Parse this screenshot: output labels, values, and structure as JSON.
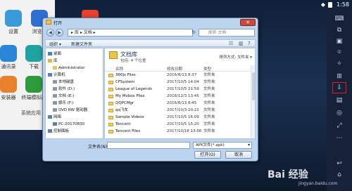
{
  "status_bar": {
    "time": "1:58"
  },
  "desktop": {
    "apps": [
      {
        "label": "设置",
        "color": "#3a9ad9"
      },
      {
        "label": "浏览器",
        "color": "#2f6fd0"
      },
      {
        "label": "通讯录",
        "color": "#2a86d6"
      },
      {
        "label": "下载",
        "color": "#1fa3a0"
      },
      {
        "label": "安装器",
        "color": "#e8812b"
      },
      {
        "label": "终端模拟器",
        "color": "#2d9b3c"
      }
    ],
    "folder_label": "系统应用",
    "brand_red": "#e8402a"
  },
  "dialog": {
    "title": "打开",
    "close": "✕",
    "address": "▸ 库 ▸ 文档 ▸",
    "search_placeholder": "搜索 文档",
    "toolbar": {
      "organize": "组织 ▾",
      "new_folder": "新建文件夹"
    },
    "nav_tree": [
      {
        "label": "桌面",
        "icon_color": "#4a7ec4",
        "indent": 0
      },
      {
        "label": "库",
        "icon_color": "#e0b84a",
        "indent": 0
      },
      {
        "label": "Administrator",
        "icon_color": "#e8c35a",
        "indent": 1
      },
      {
        "label": "计算机",
        "icon_color": "#5b7fa8",
        "indent": 0
      },
      {
        "label": "本地磁盘",
        "icon_color": "#8a97a8",
        "indent": 1
      },
      {
        "label": "软件 (D:)",
        "icon_color": "#8a97a8",
        "indent": 1
      },
      {
        "label": "文档 (E:)",
        "icon_color": "#8a97a8",
        "indent": 1
      },
      {
        "label": "娱乐 (F:)",
        "icon_color": "#8a97a8",
        "indent": 1
      },
      {
        "label": "DVD RW 驱动器",
        "icon_color": "#8a97a8",
        "indent": 1
      },
      {
        "label": "网络",
        "icon_color": "#5b7fa8",
        "indent": 0
      },
      {
        "label": "PC-20170830",
        "icon_color": "#5b7fa8",
        "indent": 1
      },
      {
        "label": "控制面板",
        "icon_color": "#5b7fa8",
        "indent": 0
      }
    ],
    "library": {
      "title": "文档库",
      "subtitle": "包括: 4 个位置",
      "arrange": "排列方式: 文件夹 ▾"
    },
    "columns": {
      "name": "名称",
      "date": "修改日期",
      "type": "类型"
    },
    "files": [
      {
        "name": "360js Files",
        "date": "2016/8/13 8:37",
        "type": "文件夹"
      },
      {
        "name": "CFSystem",
        "date": "2017/10/5 14:04",
        "type": "文件夹"
      },
      {
        "name": "League of Legends",
        "date": "2017/10/5 21:59",
        "type": "文件夹"
      },
      {
        "name": "My Mvbox Files",
        "date": "2016/12/3 13:45",
        "type": "文件夹"
      },
      {
        "name": "QQPCMgr",
        "date": "2016/8/13 8:45",
        "type": "文件夹"
      },
      {
        "name": "qq飞车",
        "date": "2017/10/3 20:21",
        "type": "文件夹"
      },
      {
        "name": "Sample Videos",
        "date": "2017/10/5 16:09",
        "type": "文件夹"
      },
      {
        "name": "Tencent",
        "date": "2017/10/5 15:20",
        "type": "文件夹"
      },
      {
        "name": "Tencent Files",
        "date": "2017/10/18 13:56",
        "type": "文件夹"
      }
    ],
    "filename_label": "文件名(N):",
    "filename_value": "",
    "filter": "APK文件(*.apk)",
    "open_button": "打开(O)",
    "cancel_button": "取消"
  },
  "watermark": {
    "main": "Bai 经验",
    "sub": "jingyan.baidu.com"
  }
}
